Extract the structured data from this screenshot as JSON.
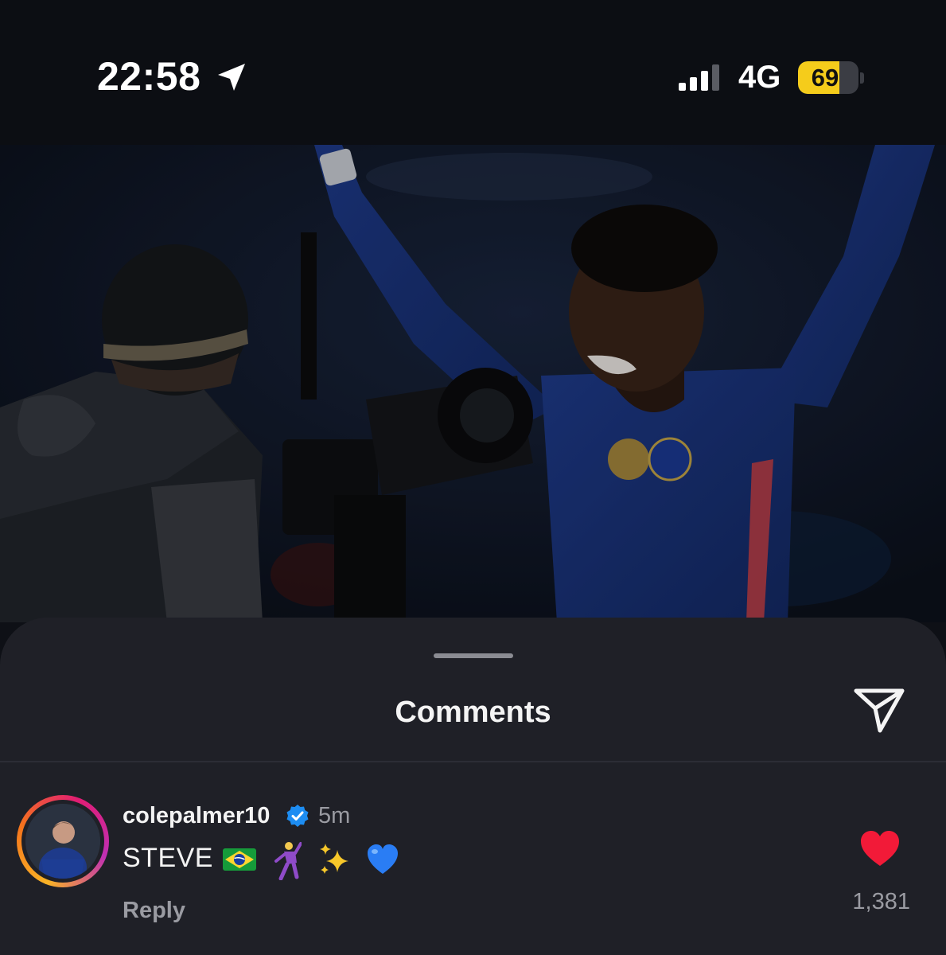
{
  "status_bar": {
    "time": "22:58",
    "network": "4G",
    "battery_level": 69,
    "battery_label": "69",
    "icons": [
      "location-arrow-icon",
      "cellular-signal-icon",
      "battery-icon"
    ]
  },
  "post": {
    "image_alt": "photo"
  },
  "comments_sheet": {
    "title": "Comments",
    "share_icon": "paper-plane-icon"
  },
  "comment": {
    "username": "colepalmer10",
    "verified": true,
    "time": "5m",
    "text": "STEVE",
    "emojis": [
      "🇧🇷",
      "🕺",
      "✨",
      "💙"
    ],
    "reply_label": "Reply",
    "like_count": "1,381",
    "liked": true
  },
  "colors": {
    "like_red": "#f21a38",
    "verified_blue": "#1d8df2",
    "battery_yellow": "#f5cc1b",
    "sheet_bg": "#1f2027"
  }
}
